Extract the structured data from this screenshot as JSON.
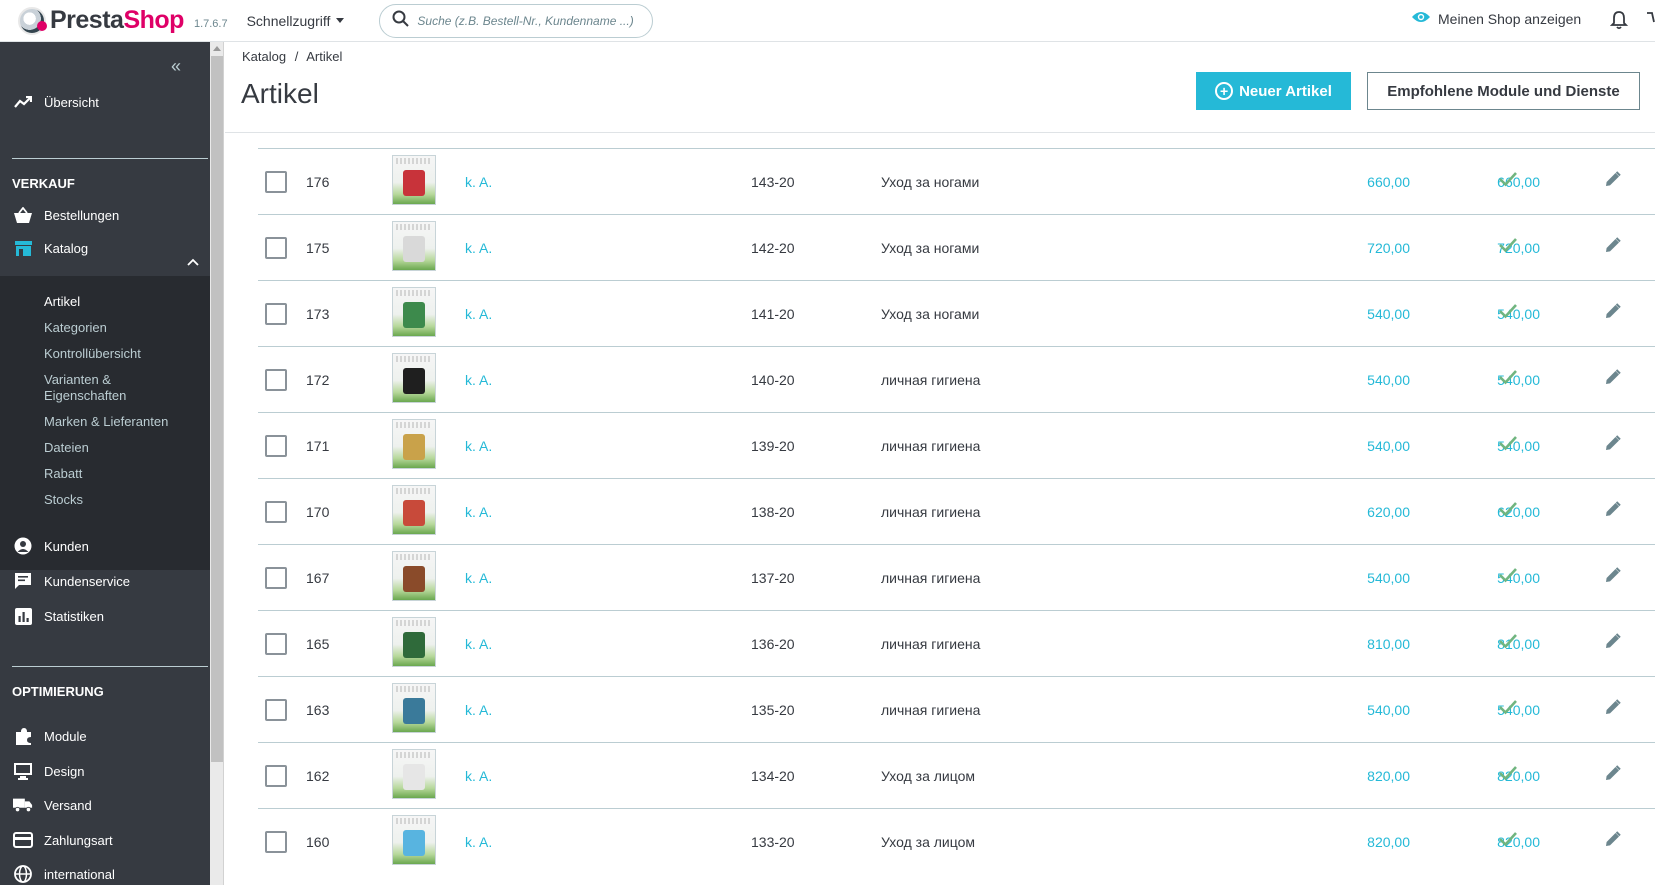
{
  "header": {
    "logo_a": "Presta",
    "logo_b": "Shop",
    "version": "1.7.6.7",
    "quick_access": "Schnellzugriff",
    "search_placeholder": "Suche (z.B. Bestell-Nr., Kundenname ...)",
    "view_shop": "Meinen Shop anzeigen"
  },
  "sidebar": {
    "collapse_icon": "«",
    "overview": "Übersicht",
    "sec_sales": "VERKAUF",
    "orders": "Bestellungen",
    "catalog": "Katalog",
    "catalog_sub": [
      "Artikel",
      "Kategorien",
      "Kontrollübersicht",
      "Varianten &",
      "Eigenschaften",
      "Marken & Lieferanten",
      "Dateien",
      "Rabatt",
      "Stocks"
    ],
    "customers": "Kunden",
    "customer_service": "Kundenservice",
    "stats": "Statistiken",
    "sec_improve": "OPTIMIERUNG",
    "modules": "Module",
    "design": "Design",
    "shipping": "Versand",
    "payment": "Zahlungsart",
    "international": "international"
  },
  "main": {
    "breadcrumb_1": "Katalog",
    "breadcrumb_sep": "/",
    "breadcrumb_2": "Artikel",
    "title": "Artikel",
    "new_button": "Neuer Artikel",
    "recommended_button": "Empfohlene Module und Dienste"
  },
  "colors": {
    "accent": "#25b9d7",
    "sidebar": "#363a41",
    "success": "#70b580"
  },
  "products": [
    {
      "id": "176",
      "name": "k. A.",
      "ref": "143-20",
      "category": "Уход за ногами",
      "price": "660,00",
      "price_tax": "660,00",
      "thumb_color": "#c8333a"
    },
    {
      "id": "175",
      "name": "k. A.",
      "ref": "142-20",
      "category": "Уход за ногами",
      "price": "720,00",
      "price_tax": "720,00",
      "thumb_color": "#d9d9d9"
    },
    {
      "id": "173",
      "name": "k. A.",
      "ref": "141-20",
      "category": "Уход за ногами",
      "price": "540,00",
      "price_tax": "540,00",
      "thumb_color": "#3d8a4c"
    },
    {
      "id": "172",
      "name": "k. A.",
      "ref": "140-20",
      "category": "личная гигиена",
      "price": "540,00",
      "price_tax": "540,00",
      "thumb_color": "#1f1f1f"
    },
    {
      "id": "171",
      "name": "k. A.",
      "ref": "139-20",
      "category": "личная гигиена",
      "price": "540,00",
      "price_tax": "540,00",
      "thumb_color": "#c9a24a"
    },
    {
      "id": "170",
      "name": "k. A.",
      "ref": "138-20",
      "category": "личная гигиена",
      "price": "620,00",
      "price_tax": "620,00",
      "thumb_color": "#c84a3a"
    },
    {
      "id": "167",
      "name": "k. A.",
      "ref": "137-20",
      "category": "личная гигиена",
      "price": "540,00",
      "price_tax": "540,00",
      "thumb_color": "#8a4b2a"
    },
    {
      "id": "165",
      "name": "k. A.",
      "ref": "136-20",
      "category": "личная гигиена",
      "price": "810,00",
      "price_tax": "810,00",
      "thumb_color": "#2f6a3a"
    },
    {
      "id": "163",
      "name": "k. A.",
      "ref": "135-20",
      "category": "личная гигиена",
      "price": "540,00",
      "price_tax": "540,00",
      "thumb_color": "#3a7a9a"
    },
    {
      "id": "162",
      "name": "k. A.",
      "ref": "134-20",
      "category": "Уход за лицом",
      "price": "820,00",
      "price_tax": "820,00",
      "thumb_color": "#e6e6e6"
    },
    {
      "id": "160",
      "name": "k. A.",
      "ref": "133-20",
      "category": "Уход за лицом",
      "price": "820,00",
      "price_tax": "820,00",
      "thumb_color": "#58b4e0"
    }
  ]
}
